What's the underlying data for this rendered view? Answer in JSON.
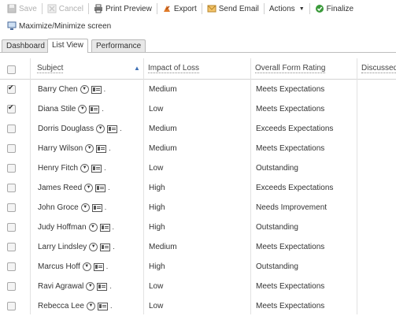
{
  "toolbar": {
    "save": "Save",
    "cancel": "Cancel",
    "print_preview": "Print Preview",
    "export": "Export",
    "send_email": "Send Email",
    "actions": "Actions",
    "finalize": "Finalize",
    "maximize": "Maximize/Minimize screen"
  },
  "tabs": [
    "Dashboard",
    "List View",
    "Performance"
  ],
  "active_tab": "List View",
  "columns": {
    "subject": "Subject",
    "impact": "Impact of Loss",
    "rating": "Overall Form Rating",
    "discussed": "Discussed"
  },
  "rows": [
    {
      "name": "Barry Chen",
      "impact": "Medium",
      "rating": "Meets Expectations",
      "checked": true
    },
    {
      "name": "Diana Stile",
      "impact": "Low",
      "rating": "Meets Expectations",
      "checked": true
    },
    {
      "name": "Dorris Douglass",
      "impact": "Medium",
      "rating": "Exceeds Expectations",
      "checked": false
    },
    {
      "name": "Harry Wilson",
      "impact": "Medium",
      "rating": "Meets Expectations",
      "checked": false
    },
    {
      "name": "Henry Fitch",
      "impact": "Low",
      "rating": "Outstanding",
      "checked": false
    },
    {
      "name": "James Reed",
      "impact": "High",
      "rating": "Exceeds Expectations",
      "checked": false
    },
    {
      "name": "John Groce",
      "impact": "High",
      "rating": "Needs Improvement",
      "checked": false
    },
    {
      "name": "Judy Hoffman",
      "impact": "High",
      "rating": "Outstanding",
      "checked": false
    },
    {
      "name": "Larry Lindsley",
      "impact": "Medium",
      "rating": "Meets Expectations",
      "checked": false
    },
    {
      "name": "Marcus Hoff",
      "impact": "High",
      "rating": "Outstanding",
      "checked": false
    },
    {
      "name": "Ravi Agrawal",
      "impact": "Low",
      "rating": "Meets Expectations",
      "checked": false
    },
    {
      "name": "Rebecca Lee",
      "impact": "Low",
      "rating": "Meets Expectations",
      "checked": false
    }
  ]
}
